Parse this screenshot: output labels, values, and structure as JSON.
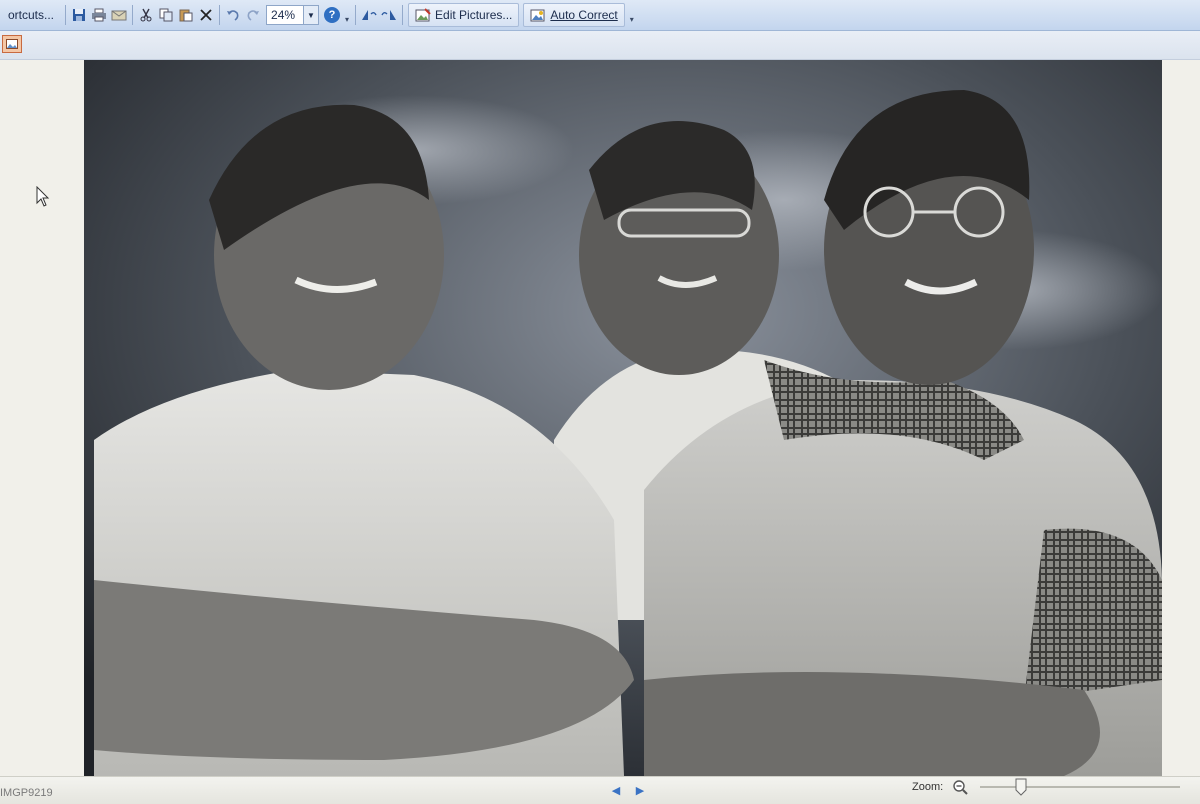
{
  "toolbar": {
    "shortcuts_label": "ortcuts...",
    "zoom_value": "24%",
    "help_label": "?",
    "edit_pictures_label": "Edit Pictures...",
    "auto_correct_label": "Auto Correct"
  },
  "status": {
    "filename": "IMGP9219",
    "zoom_label": "Zoom:"
  },
  "colors": {
    "toolbar_top": "#dfe9f6",
    "toolbar_bottom": "#c3d5ee",
    "accent": "#3b73c4",
    "thumbnail_button": "#f4c7a6"
  }
}
